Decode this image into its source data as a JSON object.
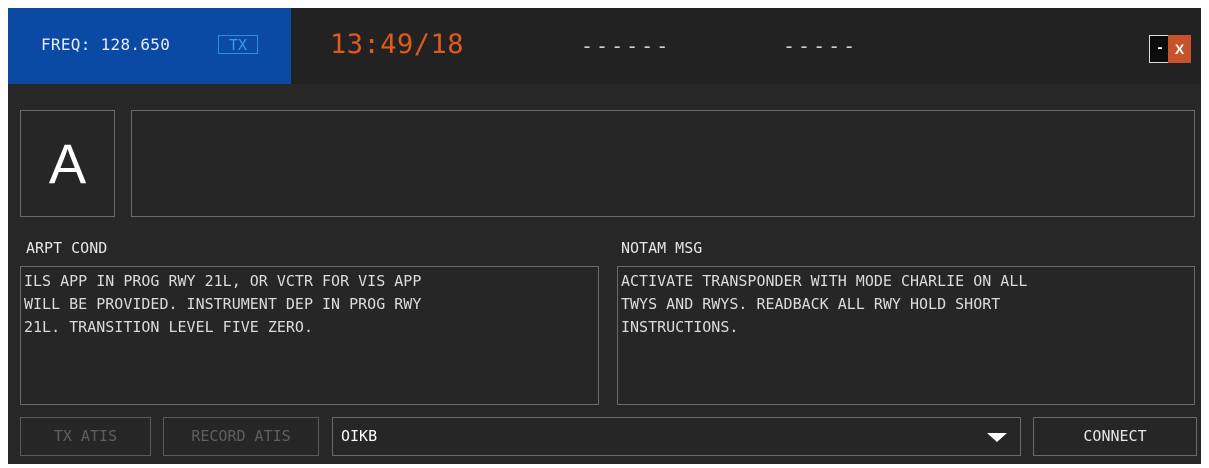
{
  "header": {
    "frequency_label": "FREQ: 128.650",
    "tx_badge": "TX",
    "clock": "13:49/18",
    "field1": "------",
    "field2": "-----",
    "minimize_label": "-",
    "close_label": "X"
  },
  "atis": {
    "letter": "A",
    "info_text": ""
  },
  "arpt_cond": {
    "label": "ARPT COND",
    "text": "ILS APP IN PROG RWY 21L, OR VCTR FOR VIS APP\nWILL BE PROVIDED. INSTRUMENT DEP IN PROG RWY\n21L. TRANSITION LEVEL FIVE ZERO."
  },
  "notam": {
    "label": "NOTAM MSG",
    "text": "ACTIVATE TRANSPONDER WITH MODE CHARLIE ON ALL\nTWYS AND RWYS. READBACK ALL RWY HOLD SHORT\nINSTRUCTIONS."
  },
  "bottom_bar": {
    "tx_atis_label": "TX ATIS",
    "record_atis_label": "RECORD ATIS",
    "airport_selected": "OIKB",
    "connect_label": "CONNECT"
  },
  "colors": {
    "freq_block": "#0a4aa5",
    "clock": "#e0591e",
    "close_button": "#c8532a",
    "window_bg": "#272727"
  },
  "icons": {
    "dropdown": "chevron-down-icon"
  }
}
